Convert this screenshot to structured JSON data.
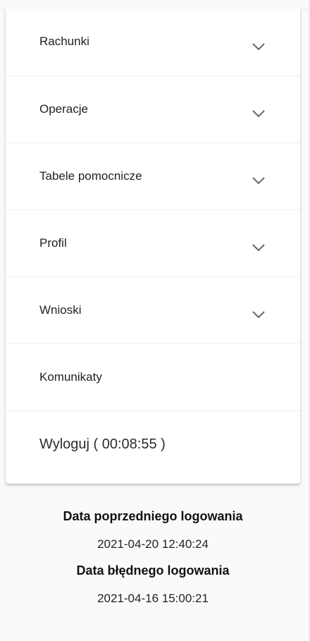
{
  "menu": {
    "items": [
      {
        "label": "Rachunki",
        "icon": "chevron-down-icon"
      },
      {
        "label": "Operacje",
        "icon": "chevron-down-icon"
      },
      {
        "label": "Tabele pomocnicze",
        "icon": "chevron-down-icon"
      },
      {
        "label": "Profil",
        "icon": "chevron-down-icon"
      },
      {
        "label": "Wnioski",
        "icon": "chevron-down-icon"
      },
      {
        "label": "Komunikaty"
      },
      {
        "label": "Wyloguj ( 00:08:55 )"
      }
    ]
  },
  "login_info": {
    "previous_label": "Data poprzedniego logowania",
    "previous_value": "2021-04-20 12:40:24",
    "failed_label": "Data błędnego logowania",
    "failed_value": "2021-04-16 15:00:21"
  },
  "colors": {
    "background": "#fafafa",
    "card": "#ffffff",
    "chevron": "#666666"
  }
}
